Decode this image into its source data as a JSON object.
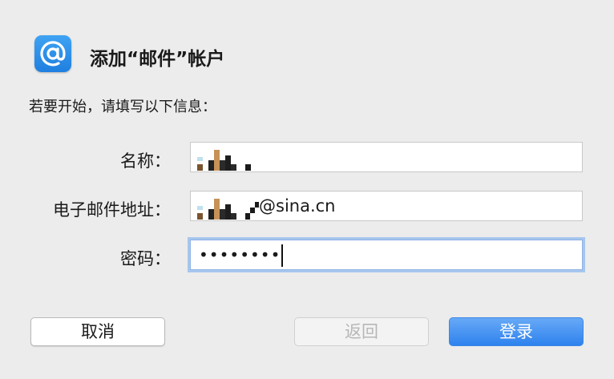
{
  "dialog": {
    "title": "添加“邮件”帐户",
    "subtitle": "若要开始，请填写以下信息：",
    "icon": "at-sign-icon"
  },
  "form": {
    "name_label": "名称：",
    "email_label": "电子邮件地址：",
    "email_suffix": "@sina.cn",
    "password_label": "密码：",
    "password_value": "••••••••"
  },
  "buttons": {
    "cancel": "取消",
    "back": "返回",
    "login": "登录"
  },
  "colors": {
    "accent": "#2e82ee",
    "focus_ring": "#a6c6ee"
  }
}
